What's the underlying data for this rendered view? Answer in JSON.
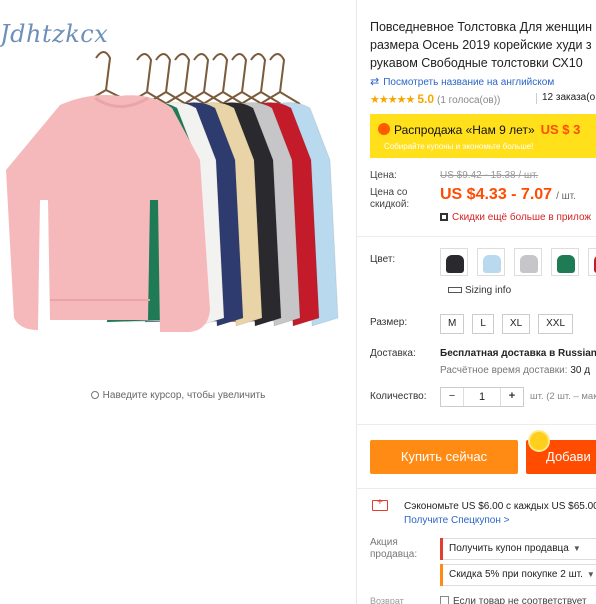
{
  "gallery": {
    "brand_watermark": "Jdhtzkcx",
    "zoom_hint": "Наведите курсор, чтобы увеличить",
    "sweater_colors": [
      "#b9d9ef",
      "#c41b2a",
      "#c6c6c8",
      "#2a2a2e",
      "#e8d4a6",
      "#2e3b6e",
      "#f2f2f0",
      "#1f7a56",
      "#f4b9b9"
    ]
  },
  "product": {
    "title_lines": [
      "Повседневное Толстовка Для женщин",
      "размера Осень 2019 корейские худи з",
      "рукавом Свободные толстовки СХ10"
    ],
    "english_name_link": "Посмотреть название на английском",
    "rating_stars": "★★★★★",
    "rating_value": "5.0",
    "votes": "(1 голоса(ов))",
    "orders": "12 заказа(о"
  },
  "promo": {
    "label": "Распродажа «Нам 9 лет»",
    "highlight": "US $ 3",
    "sub": "Собирайте купоны и экономьте больше!"
  },
  "price": {
    "old_label": "Цена:",
    "old_value": "US $9.42 - 15.38 / шт.",
    "new_label_1": "Цена со",
    "new_label_2": "скидкой:",
    "new_value": "US $4.33 - 7.07",
    "unit": "/ шт.",
    "app_discount": "Скидки ещё больше в прилож"
  },
  "options": {
    "color_label": "Цвет:",
    "swatch_colors": [
      "#2a2a2e",
      "#b9d9ef",
      "#c6c6c8",
      "#1f7a56",
      "#c41b2a"
    ],
    "sizing_info": "Sizing info",
    "size_label": "Размер:",
    "sizes": [
      "M",
      "L",
      "XL",
      "XXL"
    ]
  },
  "shipping": {
    "label": "Доставка:",
    "main": "Бесплатная доставка в Russian",
    "time_label": "Расчётное время доставки:",
    "time_value": "30 д"
  },
  "quantity": {
    "label": "Количество:",
    "minus": "−",
    "value": "1",
    "plus": "+",
    "note": "шт. (2 шт. – мак"
  },
  "actions": {
    "buy_now": "Купить сейчас",
    "add_to_cart": "Добави"
  },
  "savings": {
    "text": "Сэкономьте US $6.00 с каждых US $65.00",
    "link": "Получите Спецкупон >"
  },
  "seller_promo": {
    "label_1": "Акция",
    "label_2": "продавца:",
    "coupon": "Получить купон продавца",
    "discount": "Скидка 5% при покупке 2 шт."
  },
  "footer": {
    "label": "Возврат",
    "text": "Если товар не соответствует"
  }
}
